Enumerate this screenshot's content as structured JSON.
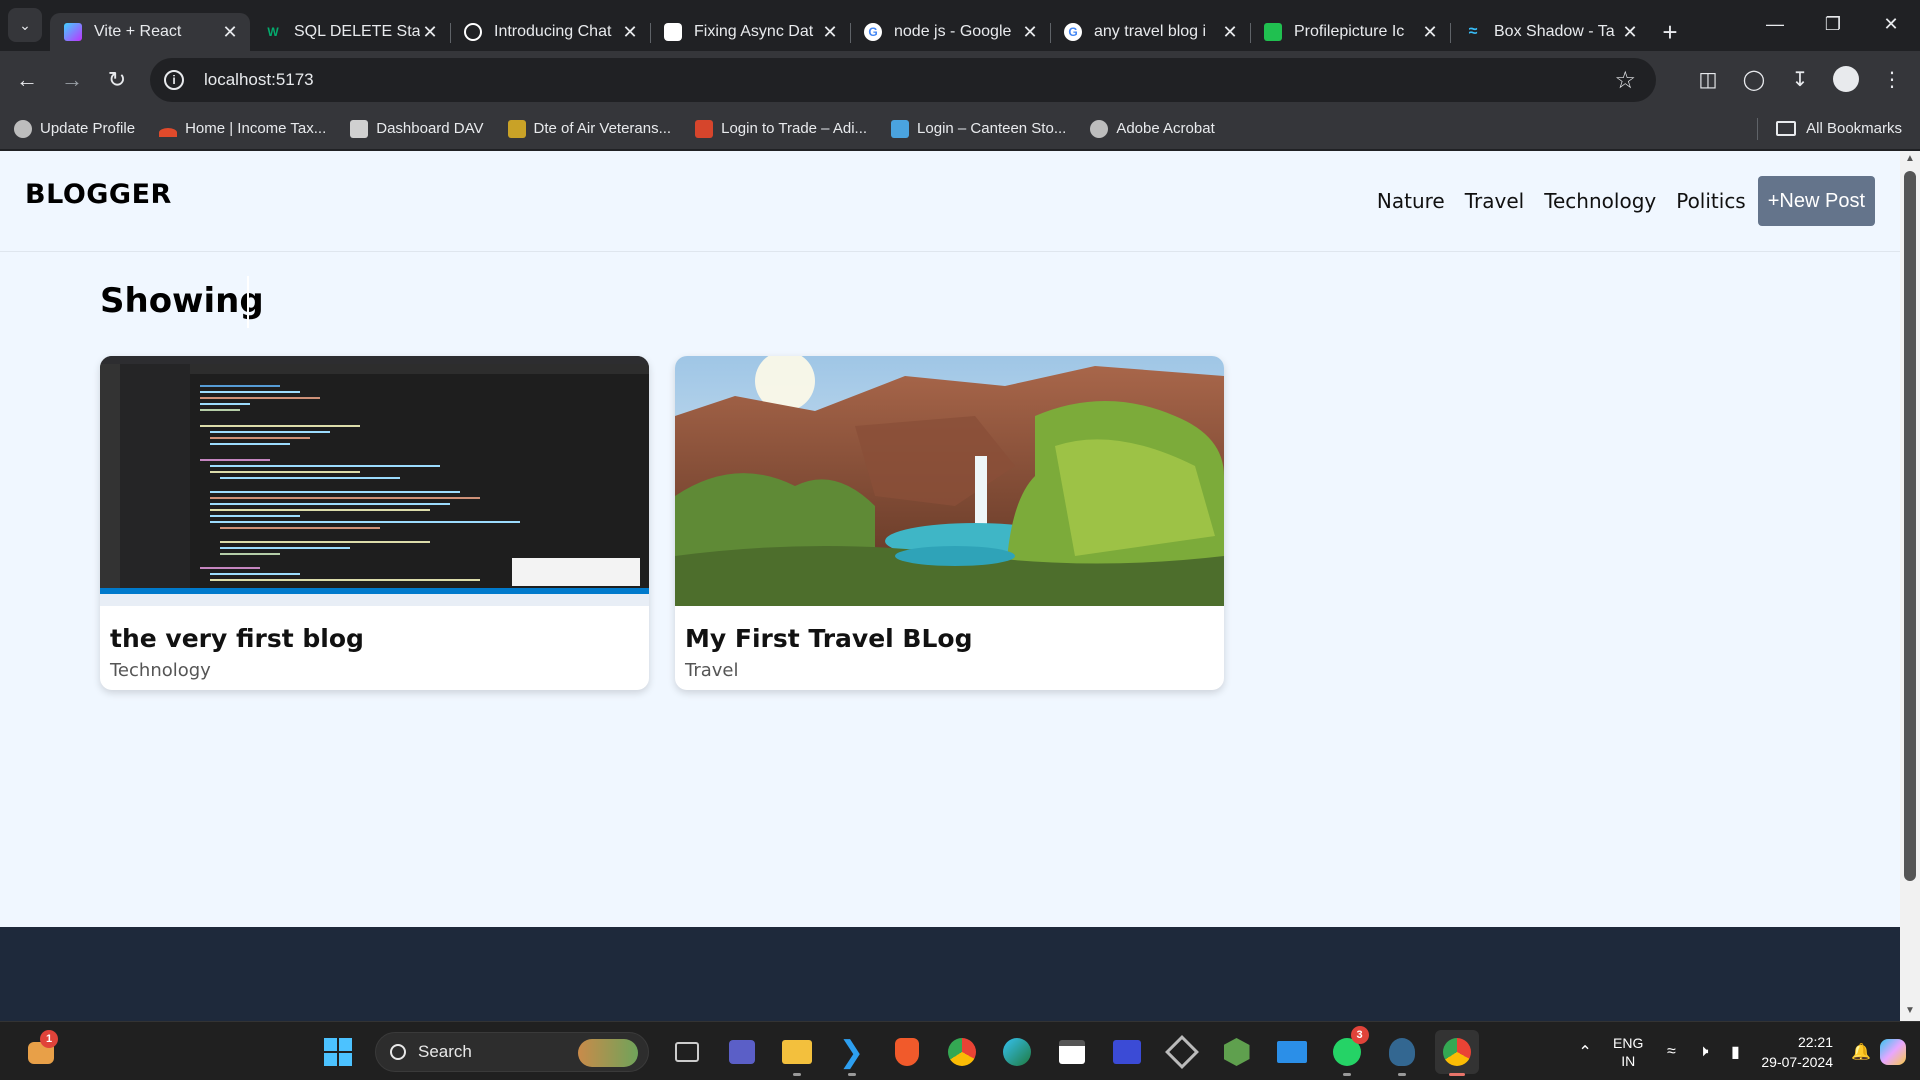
{
  "browser": {
    "tabs": [
      {
        "title": "Vite + React",
        "active": true,
        "fav_color": "#8f5bff"
      },
      {
        "title": "SQL DELETE Stat",
        "active": false,
        "fav_color": "#04aa6d"
      },
      {
        "title": "Introducing Chat",
        "active": false,
        "fav_color": "#ffffff"
      },
      {
        "title": "Fixing Async Dat",
        "active": false,
        "fav_color": "#ffffff"
      },
      {
        "title": "node js - Google",
        "active": false,
        "fav_color": "#4285f4"
      },
      {
        "title": "any travel blog i",
        "active": false,
        "fav_color": "#4285f4"
      },
      {
        "title": "Profilepicture Ic",
        "active": false,
        "fav_color": "#20c050"
      },
      {
        "title": "Box Shadow - Ta",
        "active": false,
        "fav_color": "#38bdf8"
      }
    ],
    "url": "localhost:5173",
    "bookmarks": [
      {
        "label": "Update Profile",
        "color": "#bdbdbd"
      },
      {
        "label": "Home | Income Tax...",
        "color": "#e04a2b"
      },
      {
        "label": "Dashboard DAV",
        "color": "#d0d0d0"
      },
      {
        "label": "Dte of Air Veterans...",
        "color": "#c9a227"
      },
      {
        "label": "Login to Trade – Adi...",
        "color": "#d6452c"
      },
      {
        "label": "Login – Canteen Sto...",
        "color": "#4aa3df"
      },
      {
        "label": "Adobe Acrobat",
        "color": "#bdbdbd"
      }
    ],
    "all_bookmarks": "All Bookmarks"
  },
  "site": {
    "logo": "BLOGGER",
    "nav": [
      "Nature",
      "Travel",
      "Technology",
      "Politics"
    ],
    "new_post": "+New Post",
    "heading": "Showing",
    "posts": [
      {
        "title": "the very first blog",
        "category": "Technology"
      },
      {
        "title": "My First Travel BLog",
        "category": "Travel"
      }
    ]
  },
  "taskbar": {
    "notification_count": "1",
    "search_label": "Search",
    "whatsapp_badge": "3",
    "lang_line1": "ENG",
    "lang_line2": "IN",
    "time": "22:21",
    "date": "29-07-2024"
  }
}
